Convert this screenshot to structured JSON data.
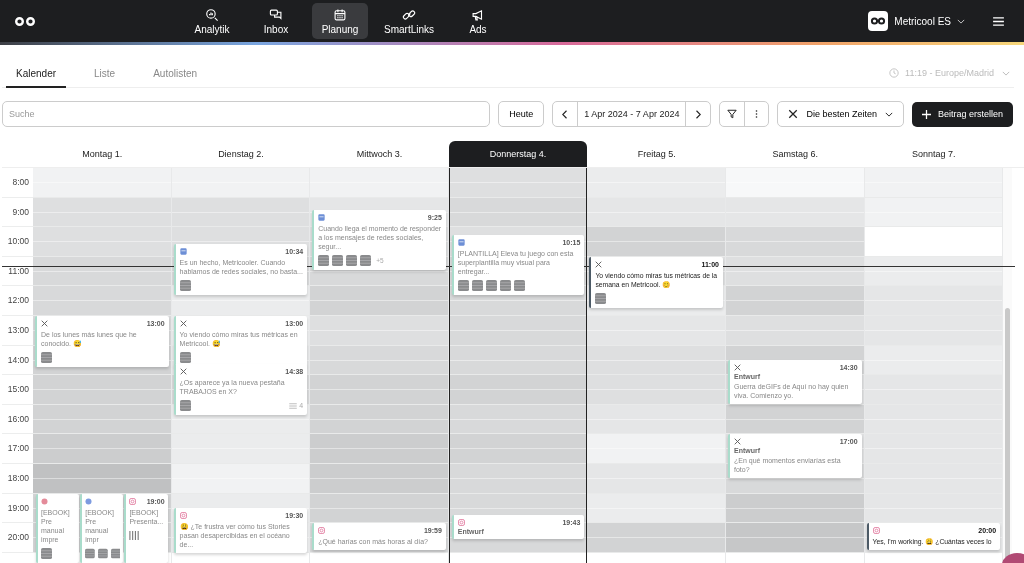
{
  "nav": [
    {
      "kind": "analytics",
      "label": "Analytik",
      "selected": false
    },
    {
      "kind": "inbox",
      "label": "Inbox",
      "selected": false
    },
    {
      "kind": "calendar",
      "label": "Planung",
      "selected": true
    },
    {
      "kind": "link",
      "label": "SmartLinks",
      "selected": false
    },
    {
      "kind": "megaphone",
      "label": "Ads",
      "selected": false
    }
  ],
  "account": {
    "name": "Metricool ES"
  },
  "tabs": [
    {
      "label": "Kalender",
      "selected": true
    },
    {
      "label": "Liste",
      "selected": false
    },
    {
      "label": "Autolisten",
      "selected": false
    }
  ],
  "clock": "11:19 - Europe/Madrid",
  "toolbar": {
    "search": {
      "placeholder": "Suche"
    },
    "today": "Heute",
    "range": "1 Apr 2024 - 7 Apr 2024",
    "best_times": "Die besten Zeiten",
    "create": "Beitrag erstellen"
  },
  "hours": [
    "8:00",
    "9:00",
    "10:00",
    "11:00",
    "12:00",
    "13:00",
    "14:00",
    "15:00",
    "16:00",
    "17:00",
    "18:00",
    "19:00",
    "20:00"
  ],
  "days": [
    {
      "label": "Montag 1.",
      "selected": false,
      "slots": [
        {
          "color": "#f1f2f3"
        },
        {
          "color": "#dedfe0"
        },
        {
          "color": "#dedfe0"
        },
        {
          "color": "#d8d9da"
        },
        {
          "color": "#d8d9da"
        },
        {
          "color": "#d8d9da"
        },
        {
          "color": "#d2d3d4"
        },
        {
          "color": "#d2d3d4"
        },
        {
          "color": "#d2d3d4"
        },
        {
          "color": "#cccdce"
        },
        {
          "color": "#c0c1c2"
        },
        {
          "color": "#d2d3d4"
        },
        {
          "color": "#d2d3d4"
        }
      ],
      "posts": [
        {
          "kind": "x",
          "time": "13:00",
          "text": "De los lunes más lunes que he conocido. 😅",
          "emphasis": false
        },
        {
          "kind": "stack",
          "time": "19:00",
          "items": [
            {
              "kind": "pinterest",
              "text": "[EBOOK] Pre manual impre"
            },
            {
              "kind": "facebook",
              "text": "[EBOOK] Pre manual impr"
            },
            {
              "kind": "instagram",
              "text": "[EBOOK] Presenta...",
              "media": [
                {
                  "kind": "carousel"
                }
              ]
            }
          ]
        }
      ]
    },
    {
      "label": "Dienstag 2.",
      "selected": false,
      "slots": [
        {
          "color": "#f1f2f3"
        },
        {
          "color": "#dedfe0"
        },
        {
          "color": "#dedfe0"
        },
        {
          "color": "#d8d9da"
        },
        {
          "color": "#ebeced"
        },
        {
          "color": "#ebeced"
        },
        {
          "color": "#e5e6e7"
        },
        {
          "color": "#d8d9da"
        },
        {
          "color": "#ebeced"
        },
        {
          "color": "#ebeced"
        },
        {
          "color": "#f1f2f3"
        },
        {
          "color": "#ebeced"
        },
        {
          "color": "#ebeced"
        }
      ],
      "posts": [
        {
          "kind": "linkedin",
          "time": "10:34",
          "text": "Es un hecho, Metricooler. Cuando hablamos de redes sociales, no basta...",
          "emphasis": false
        },
        {
          "kind": "x",
          "time": "13:00",
          "text": "Yo viendo cómo miras tus métricas en Metricool. 😅",
          "emphasis": false
        },
        {
          "kind": "x",
          "time": "14:38",
          "text": "¿Os aparece ya la nueva pestaña TRABAJOS en X?",
          "count": "4",
          "emphasis": false
        },
        {
          "kind": "instagram",
          "time": "19:30",
          "text": "😩 ¿Te frustra ver cómo tus Stories pasan desapercibidas en el océano de...",
          "emphasis": false
        }
      ]
    },
    {
      "label": "Mittwoch 3.",
      "selected": false,
      "slots": [
        {
          "color": "#f1f2f3"
        },
        {
          "color": "#e5e6e7"
        },
        {
          "color": "#dedfe0"
        },
        {
          "color": "#d8d9da"
        },
        {
          "color": "#d2d3d4"
        },
        {
          "color": "#dedfe0"
        },
        {
          "color": "#d8d9da"
        },
        {
          "color": "#d2d3d4"
        },
        {
          "color": "#d2d3d4"
        },
        {
          "color": "#cccdce"
        },
        {
          "color": "#cccdce"
        },
        {
          "color": "#d2d3d4"
        },
        {
          "color": "#d8d9da"
        }
      ],
      "posts": [
        {
          "kind": "linkedin",
          "time": "9:25",
          "text": "Cuando llega el momento de responder a los mensajes de redes sociales, segur...",
          "more": "+5",
          "emphasis": false
        },
        {
          "kind": "instagram",
          "time": "19:59",
          "text": "¿Qué harías con más horas al día?",
          "emphasis": false
        }
      ]
    },
    {
      "label": "Donnerstag 4.",
      "selected": true,
      "slots": [
        {
          "color": "#dedfe0"
        },
        {
          "color": "#d8d9da"
        },
        {
          "color": "#dedfe0"
        },
        {
          "color": "#d8d9da"
        },
        {
          "color": "#d8d9da"
        },
        {
          "color": "#d8d9da"
        },
        {
          "color": "#d8d9da"
        },
        {
          "color": "#d2d3d4"
        },
        {
          "color": "#d8d9da"
        },
        {
          "color": "#d2d3d4"
        },
        {
          "color": "#d8d9da"
        },
        {
          "color": "#d8d9da"
        },
        {
          "color": "#d8d9da"
        }
      ],
      "posts": [
        {
          "kind": "linkedin",
          "time": "10:15",
          "text": "[PLANTILLA] Eleva tu juego con esta superplantilla muy visual para entregar...",
          "emphasis": false
        },
        {
          "kind": "instagram",
          "time": "19:43",
          "status": "Entwurf",
          "emphasis": false
        }
      ]
    },
    {
      "label": "Freitag 5.",
      "selected": false,
      "slots": [
        {
          "color": "#ebeced"
        },
        {
          "color": "#e5e6e7"
        },
        {
          "color": "#d2d3d4"
        },
        {
          "color": "#dedfe0"
        },
        {
          "color": "#ebeced"
        },
        {
          "color": "#e5e6e7"
        },
        {
          "color": "#dedfe0"
        },
        {
          "color": "#dedfe0"
        },
        {
          "color": "#e5e6e7"
        },
        {
          "color": "#f1f2f3"
        },
        {
          "color": "#e5e6e7"
        },
        {
          "color": "#ebeced"
        },
        {
          "color": "#d2d3d4"
        }
      ],
      "posts": [
        {
          "kind": "x",
          "time": "11:00",
          "text": "Yo viendo cómo miras tus métricas de la semana en Metricool. 😊",
          "emphasis": true
        }
      ]
    },
    {
      "label": "Samstag 6.",
      "selected": false,
      "slots": [
        {
          "color": "#f7f8f9"
        },
        {
          "color": "#e5e6e7"
        },
        {
          "color": "#d8d9da"
        },
        {
          "color": "#dedfe0"
        },
        {
          "color": "#d2d3d4"
        },
        {
          "color": "#dedfe0"
        },
        {
          "color": "#d2d3d4"
        },
        {
          "color": "#dedfe0"
        },
        {
          "color": "#d2d3d4"
        },
        {
          "color": "#dedfe0"
        },
        {
          "color": "#d8d9da"
        },
        {
          "color": "#cccdce"
        },
        {
          "color": "#c6c7c8"
        }
      ],
      "posts": [
        {
          "kind": "x",
          "time": "14:30",
          "status": "Entwurf",
          "text": "Guerra deGIFs de Aquí no hay quien viva. Comienzo yo.",
          "emphasis": false
        },
        {
          "kind": "x",
          "time": "17:00",
          "status": "Entwurf",
          "text": "¿En qué momentos enviarías esta foto?",
          "emphasis": false
        }
      ]
    },
    {
      "label": "Sonntag 7.",
      "selected": false,
      "slots": [
        {
          "color": "#f1f2f3"
        },
        {
          "color": "#f1f2f3"
        },
        {
          "color": "#ffffff"
        },
        {
          "color": "#ebeced"
        },
        {
          "color": "#e5e6e7"
        },
        {
          "color": "#e5e6e7"
        },
        {
          "color": "#ebeced"
        },
        {
          "color": "#e5e6e7"
        },
        {
          "color": "#e5e6e7"
        },
        {
          "color": "#e5e6e7"
        },
        {
          "color": "#e5e6e7"
        },
        {
          "color": "#e5e6e7"
        },
        {
          "color": "#e5e6e7"
        }
      ],
      "posts": [
        {
          "kind": "instagram",
          "time": "20:00",
          "text": "Yes, I'm working. 😩 ¿Cuántas veces lo",
          "emphasis": true
        }
      ]
    }
  ]
}
